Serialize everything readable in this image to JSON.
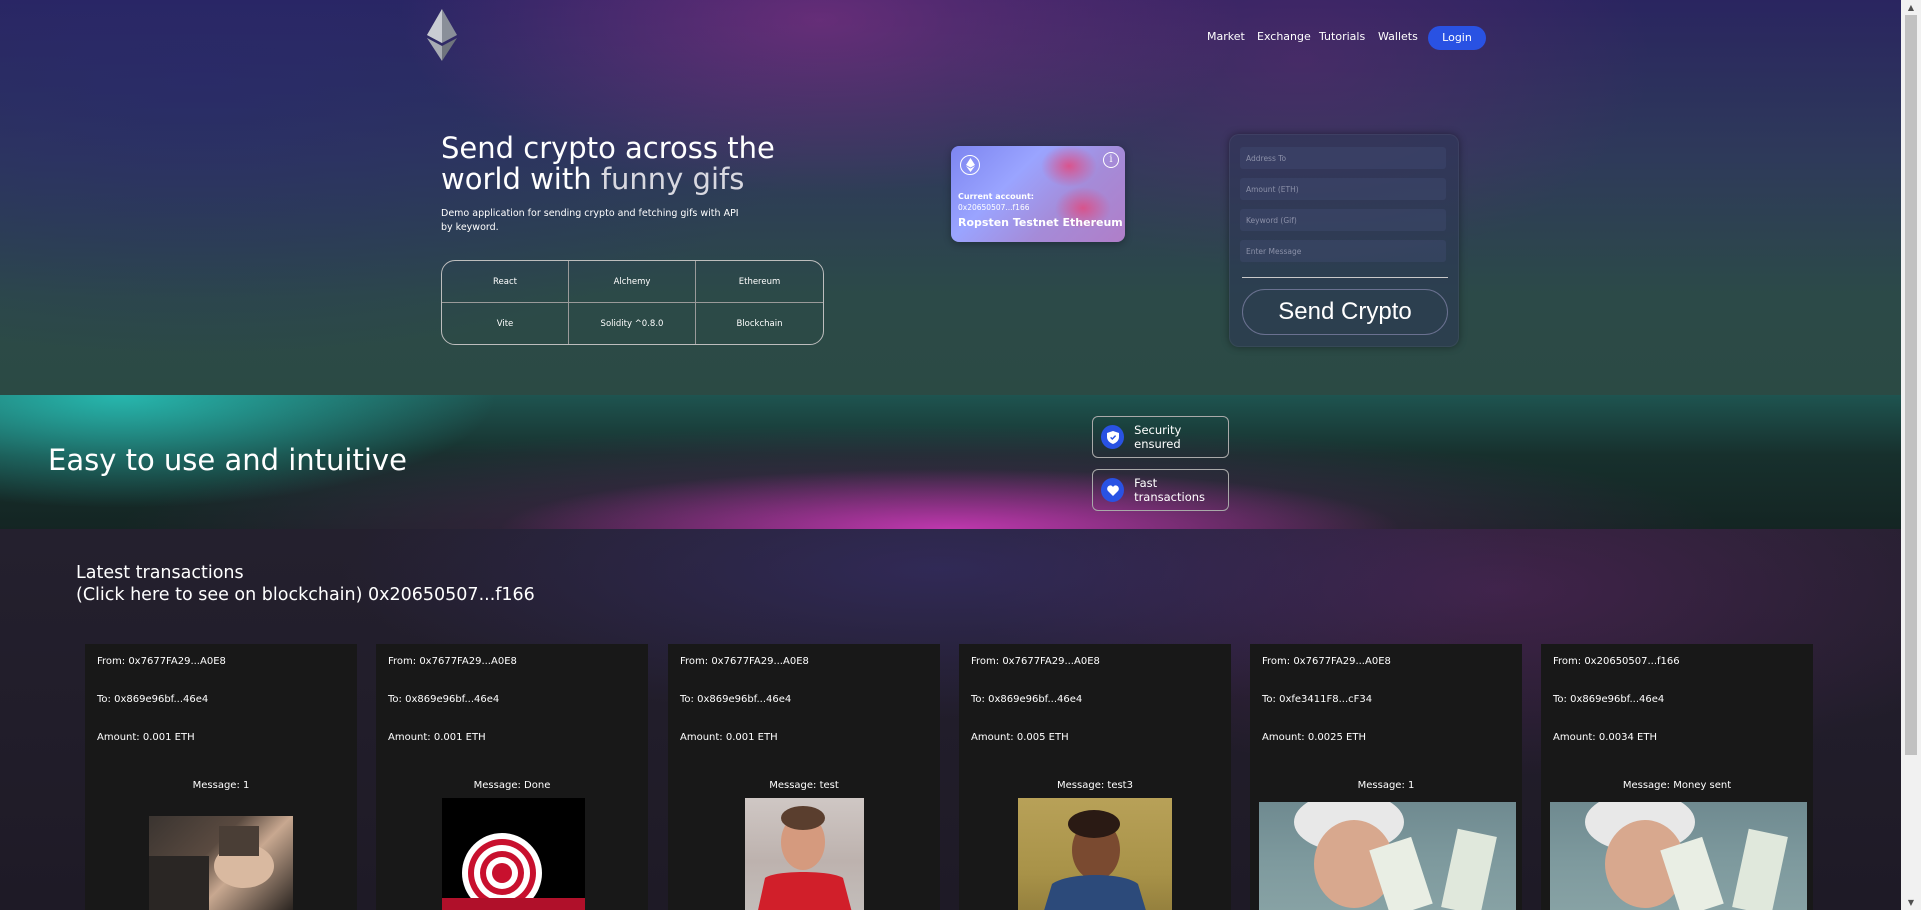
{
  "nav": {
    "links": [
      "Market",
      "Exchange",
      "Tutorials",
      "Wallets"
    ],
    "login_label": "Login"
  },
  "hero": {
    "title_line1": "Send crypto across the",
    "title_line2_a": "world with ",
    "title_line2_b": "funny gifs",
    "subtitle": "Demo application for sending crypto and fetching gifs with API by keyword.",
    "tech": [
      "React",
      "Alchemy",
      "Ethereum",
      "Vite",
      "Solidity ^0.8.0",
      "Blockchain"
    ]
  },
  "card": {
    "account_label": "Current account:",
    "account_address": "0x20650507...f166",
    "network": "Ropsten Testnet Ethereum",
    "info_symbol": "i"
  },
  "form": {
    "address_placeholder": "Address To",
    "amount_placeholder": "Amount (ETH)",
    "keyword_placeholder": "Keyword (Gif)",
    "message_placeholder": "Enter Message",
    "send_label": "Send Crypto"
  },
  "services": {
    "title": "Easy to use and intuitive",
    "items": [
      {
        "label": "Security ensured",
        "icon": "shield-icon"
      },
      {
        "label": "Fast transactions",
        "icon": "heart-icon"
      }
    ]
  },
  "transactions": {
    "heading_line1": "Latest transactions",
    "heading_line2": "(Click here to see on blockchain) 0x20650507...f166",
    "items": [
      {
        "from": "From: 0x7677FA29...A0E8",
        "to": "To: 0x869e96bf...46e4",
        "amount": "Amount: 0.001 ETH",
        "message": "Message: 1"
      },
      {
        "from": "From: 0x7677FA29...A0E8",
        "to": "To: 0x869e96bf...46e4",
        "amount": "Amount: 0.001 ETH",
        "message": "Message: Done"
      },
      {
        "from": "From: 0x7677FA29...A0E8",
        "to": "To: 0x869e96bf...46e4",
        "amount": "Amount: 0.001 ETH",
        "message": "Message: test"
      },
      {
        "from": "From: 0x7677FA29...A0E8",
        "to": "To: 0x869e96bf...46e4",
        "amount": "Amount: 0.005 ETH",
        "message": "Message: test3"
      },
      {
        "from": "From: 0x7677FA29...A0E8",
        "to": "To: 0xfe3411F8...cF34",
        "amount": "Amount: 0.0025 ETH",
        "message": "Message: 1"
      },
      {
        "from": "From: 0x20650507...f166",
        "to": "To: 0x869e96bf...46e4",
        "amount": "Amount: 0.0034 ETH",
        "message": "Message: Money sent"
      }
    ]
  },
  "colors": {
    "accent": "#2952e3",
    "card_bg": "#181818"
  }
}
